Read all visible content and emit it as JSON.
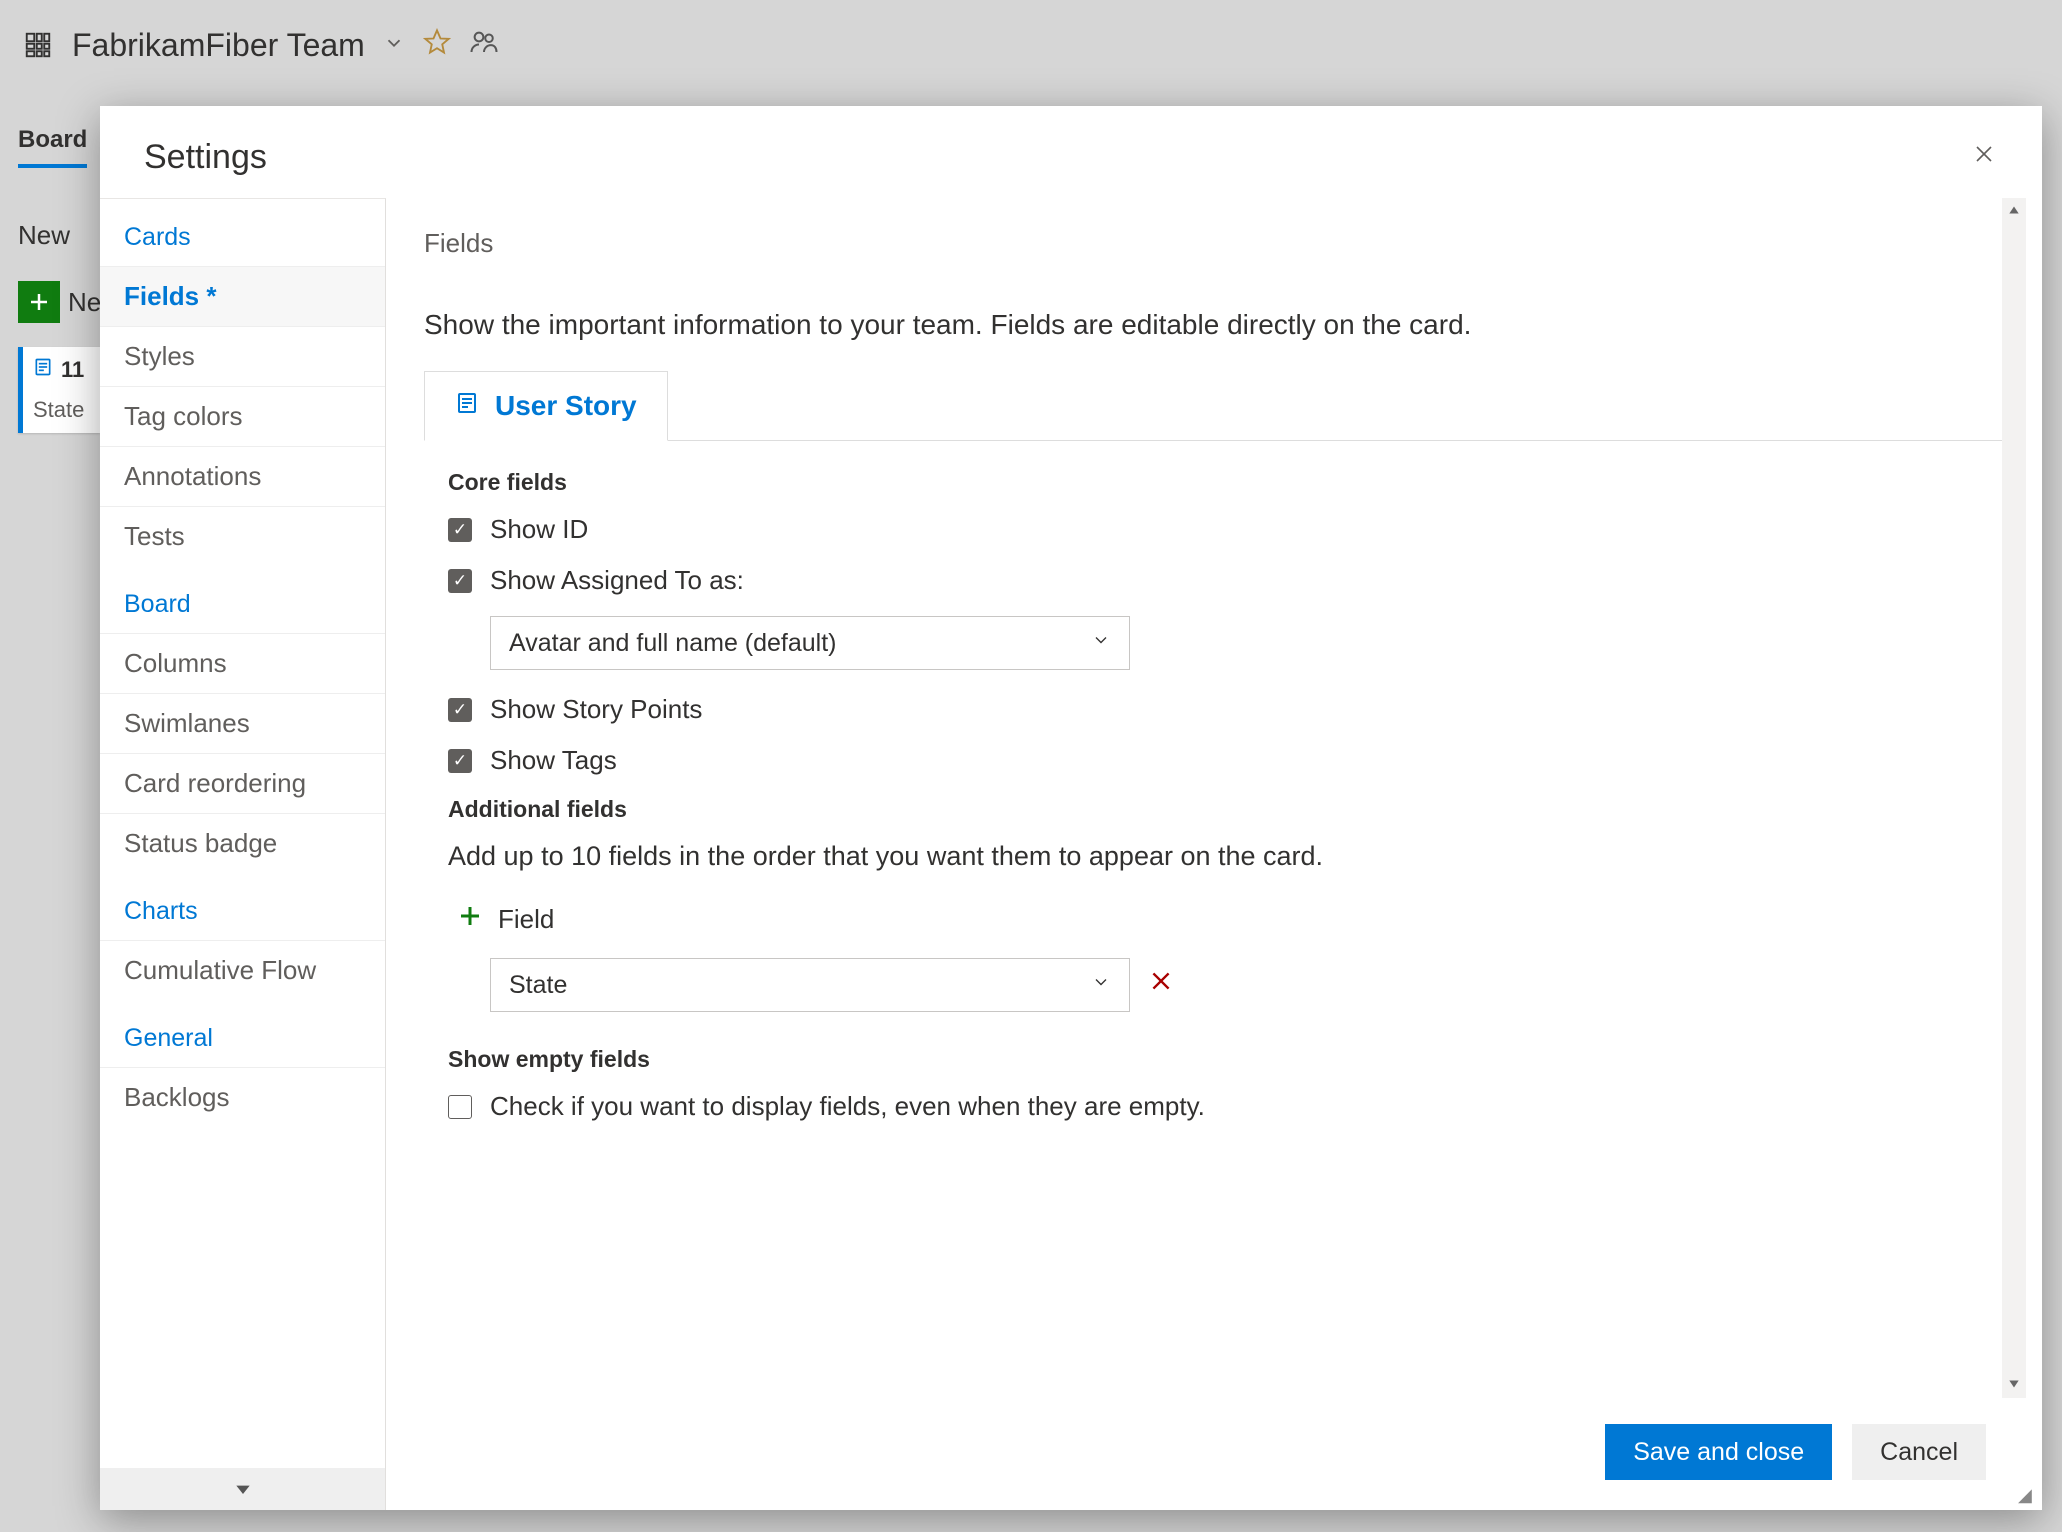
{
  "header": {
    "team_name": "FabrikamFiber Team"
  },
  "tabs": {
    "board": "Board"
  },
  "column": {
    "new": "New",
    "new_item": "Ne"
  },
  "card": {
    "id": "11",
    "state_label": "State"
  },
  "dialog": {
    "title": "Settings",
    "close": "✕",
    "save": "Save and close",
    "cancel": "Cancel"
  },
  "nav": {
    "sections": {
      "cards": "Cards",
      "board": "Board",
      "charts": "Charts",
      "general": "General"
    },
    "items": {
      "fields": "Fields *",
      "styles": "Styles",
      "tag_colors": "Tag colors",
      "annotations": "Annotations",
      "tests": "Tests",
      "columns": "Columns",
      "swimlanes": "Swimlanes",
      "card_reordering": "Card reordering",
      "status_badge": "Status badge",
      "cumulative_flow": "Cumulative Flow",
      "backlogs": "Backlogs"
    }
  },
  "main": {
    "title": "Fields",
    "description": "Show the important information to your team. Fields are editable directly on the card.",
    "workitem_tab": "User Story",
    "core_fields_header": "Core fields",
    "checks": {
      "show_id": "Show ID",
      "show_assigned": "Show Assigned To as:",
      "show_story_points": "Show Story Points",
      "show_tags": "Show Tags"
    },
    "assigned_select": "Avatar and full name (default)",
    "additional_header": "Additional fields",
    "additional_desc": "Add up to 10 fields in the order that you want them to appear on the card.",
    "add_field_label": "Field",
    "field_select": "State",
    "empty_header": "Show empty fields",
    "empty_desc": "Check if you want to display fields, even when they are empty."
  }
}
